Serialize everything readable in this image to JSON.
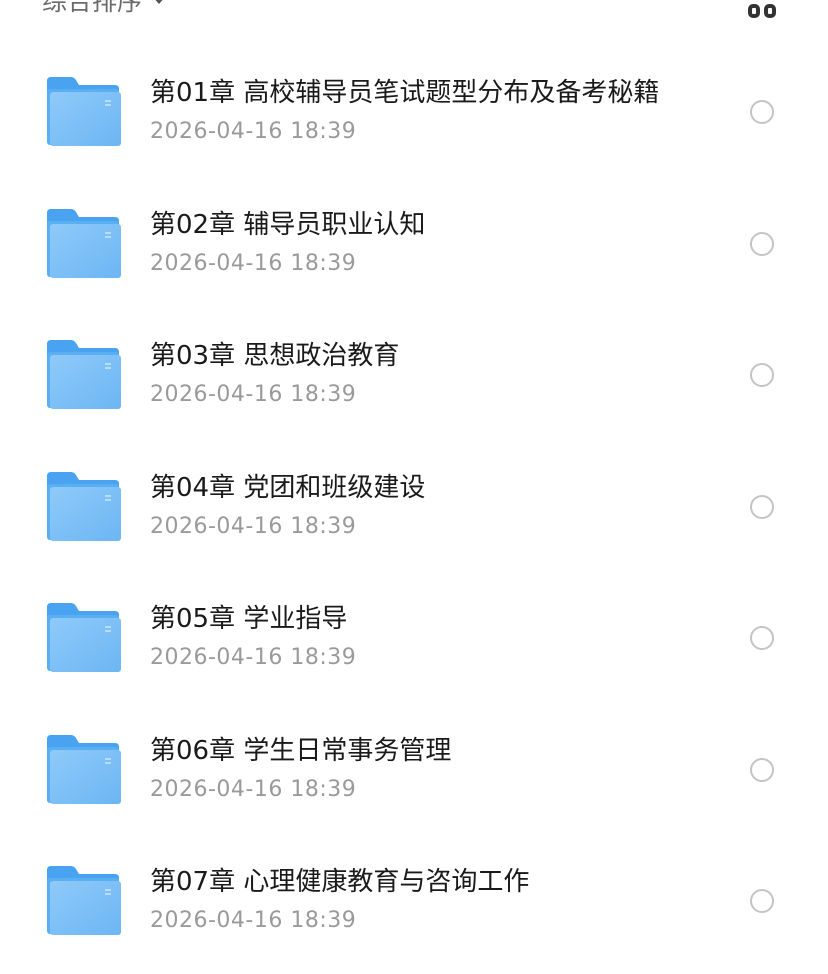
{
  "toolbar": {
    "sort_label": "综合排序",
    "sort_icon": "chevron-down-icon",
    "view_icon": "grid-view-icon"
  },
  "colors": {
    "folder_top": "#4aa3f0",
    "folder_body": "#7cc0f7",
    "title_text": "#1a1a1a",
    "date_text": "#9a9a9a",
    "radio_border": "#c4c4c4"
  },
  "folders": [
    {
      "title": "第01章 高校辅导员笔试题型分布及备考秘籍",
      "date": "2026-04-16 18:39"
    },
    {
      "title": "第02章 辅导员职业认知",
      "date": "2026-04-16 18:39"
    },
    {
      "title": "第03章 思想政治教育",
      "date": "2026-04-16 18:39"
    },
    {
      "title": "第04章 党团和班级建设",
      "date": "2026-04-16 18:39"
    },
    {
      "title": "第05章 学业指导",
      "date": "2026-04-16 18:39"
    },
    {
      "title": "第06章 学生日常事务管理",
      "date": "2026-04-16 18:39"
    },
    {
      "title": "第07章 心理健康教育与咨询工作",
      "date": "2026-04-16 18:39"
    }
  ]
}
